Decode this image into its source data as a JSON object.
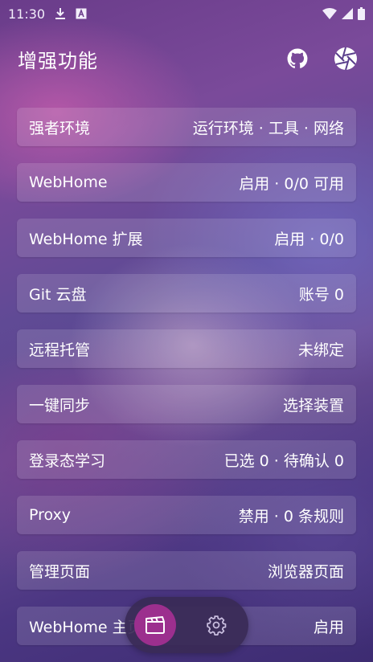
{
  "status_bar": {
    "time": "11:30",
    "icons": [
      "download-icon",
      "font-icon",
      "wifi-icon",
      "signal-icon",
      "battery-icon"
    ]
  },
  "app_bar": {
    "title": "增强功能",
    "actions": [
      "github-icon",
      "aperture-icon"
    ]
  },
  "items": [
    {
      "label": "强者环境",
      "value": "运行环境 · 工具 · 网络"
    },
    {
      "label": "WebHome",
      "value": "启用 · 0/0 可用"
    },
    {
      "label": "WebHome 扩展",
      "value": "启用 · 0/0"
    },
    {
      "label": "Git 云盘",
      "value": "账号 0"
    },
    {
      "label": "远程托管",
      "value": "未绑定"
    },
    {
      "label": "一键同步",
      "value": "选择装置"
    },
    {
      "label": "登录态学习",
      "value": "已选 0 · 待确认 0"
    },
    {
      "label": "Proxy",
      "value": "禁用 · 0 条规则"
    },
    {
      "label": "管理页面",
      "value": "浏览器页面"
    },
    {
      "label": "WebHome 主页设置",
      "value": "启用"
    }
  ],
  "bottom_nav": {
    "items": [
      "clapperboard-icon",
      "gear-icon"
    ],
    "active_color": "#9c2f8e"
  }
}
